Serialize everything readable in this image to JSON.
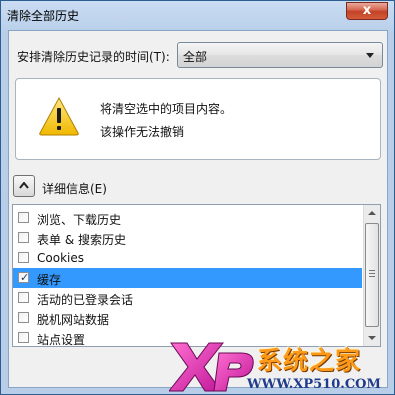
{
  "window": {
    "title": "清除全部历史",
    "close_label": "x"
  },
  "time_range": {
    "label": "安排清除历史记录的时间(T):",
    "selected": "全部"
  },
  "warning": {
    "icon": "warning-triangle-icon",
    "line1": "将清空选中的项目内容。",
    "line2": "该操作无法撤销"
  },
  "details": {
    "label": "详细信息(E)",
    "expanded": true
  },
  "items": [
    {
      "label": "浏览、下载历史",
      "checked": false,
      "selected": false
    },
    {
      "label": "表单 & 搜索历史",
      "checked": false,
      "selected": false
    },
    {
      "label": "Cookies",
      "checked": false,
      "selected": false
    },
    {
      "label": "缓存",
      "checked": true,
      "selected": true
    },
    {
      "label": "活动的已登录会话",
      "checked": false,
      "selected": false
    },
    {
      "label": "脱机网站数据",
      "checked": false,
      "selected": false
    },
    {
      "label": "站点设置",
      "checked": false,
      "selected": false
    }
  ],
  "watermark": {
    "brand": "系统之家",
    "url": "WWW.XP510.COM"
  },
  "colors": {
    "selection": "#3399ff",
    "warning_yellow": "#f5c518"
  }
}
